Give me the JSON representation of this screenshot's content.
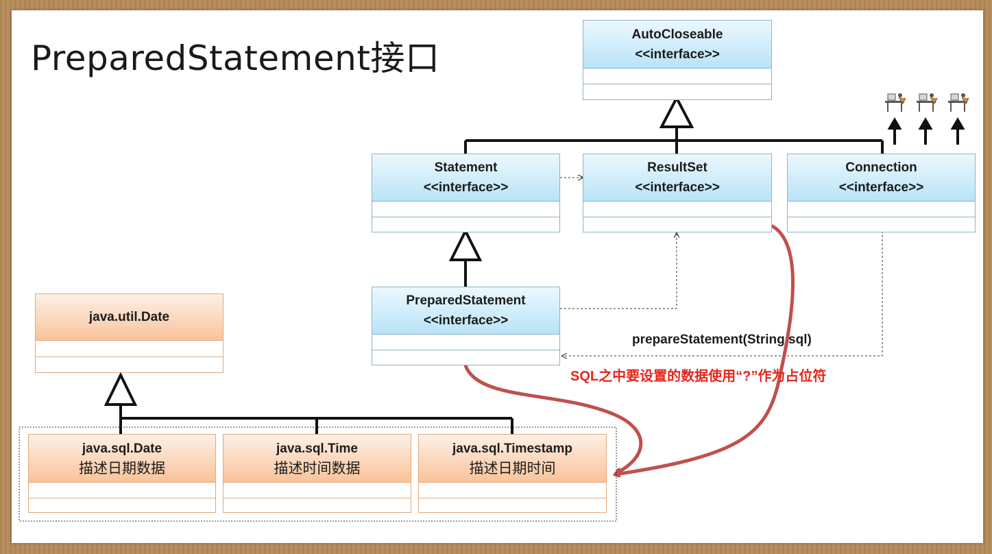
{
  "slide": {
    "title": "PreparedStatement接口"
  },
  "classes": {
    "autocloseable": {
      "name": "AutoCloseable",
      "stereotype": "<<interface>>"
    },
    "statement": {
      "name": "Statement",
      "stereotype": "<<interface>>"
    },
    "resultset": {
      "name": "ResultSet",
      "stereotype": "<<interface>>"
    },
    "connection": {
      "name": "Connection",
      "stereotype": "<<interface>>"
    },
    "preparedstatement": {
      "name": "PreparedStatement",
      "stereotype": "<<interface>>"
    },
    "util_date": {
      "name": "java.util.Date"
    },
    "sql_date": {
      "name": "java.sql.Date",
      "desc": "描述日期数据"
    },
    "sql_time": {
      "name": "java.sql.Time",
      "desc": "描述时间数据"
    },
    "sql_timestamp": {
      "name": "java.sql.Timestamp",
      "desc": "描述日期时间"
    }
  },
  "annotations": {
    "method": "prepareStatement(String sql)",
    "note": "SQL之中要设置的数据使用“?”作为占位符"
  },
  "colors": {
    "interface_header": "#b8e3f7",
    "date_header": "#f9c39a",
    "note_text": "#e8241b",
    "arrow_curve": "#c0504d"
  },
  "icons": [
    "desk-user-icon",
    "desk-user-icon",
    "desk-user-icon"
  ]
}
